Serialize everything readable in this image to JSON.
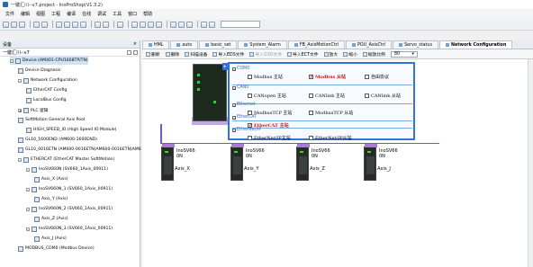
{
  "window": {
    "title": "一键汇川--v7.project - InoProShop(V1.3.2)"
  },
  "menu": [
    "文件",
    "编辑",
    "视图",
    "工程",
    "编译",
    "在线",
    "调试",
    "工具",
    "窗口",
    "帮助"
  ],
  "left_panel": {
    "title": "设备",
    "subtitle": "一键汇川--v7",
    "tree": [
      {
        "label": "Device (AM401-CPU1608TP/TN)",
        "indent": 1,
        "exp": "-",
        "sel": true
      },
      {
        "label": "Device Diagnosis",
        "indent": 2
      },
      {
        "label": "Network Configuration",
        "indent": 2,
        "exp": "-"
      },
      {
        "label": "EtherCAT Config",
        "indent": 3
      },
      {
        "label": "LocalBus Config",
        "indent": 3
      },
      {
        "label": "PLC 逻辑",
        "indent": 2,
        "exp": "+"
      },
      {
        "label": "SoftMotion General Axis Pool",
        "indent": 2
      },
      {
        "label": "HIGH_SPEED_IO (High Speed IO Module)",
        "indent": 3
      },
      {
        "label": "GL10_1600END (AM600-1600END)",
        "indent": 2
      },
      {
        "label": "GL10_0016ETN (AM600-0016ETN)AM600-0016ETN)AM6",
        "indent": 2
      },
      {
        "label": "ETHERCAT (EtherCAT Master SoftMotion)",
        "indent": 2,
        "exp": "-"
      },
      {
        "label": "InoSV660N (SV660_1Axis_00911)",
        "indent": 3,
        "exp": "-"
      },
      {
        "label": "Axis_X (Axis)",
        "indent": 4
      },
      {
        "label": "InoSV660N_1 (SV660_1Axis_00911)",
        "indent": 3,
        "exp": "-"
      },
      {
        "label": "Axis_Y (Axis)",
        "indent": 4
      },
      {
        "label": "InoSV660N_2 (SV660_1Axis_00911)",
        "indent": 3,
        "exp": "-"
      },
      {
        "label": "Axis_Z (Axis)",
        "indent": 4
      },
      {
        "label": "InoSV660N_3 (SV660_1Axis_00911)",
        "indent": 3,
        "exp": "-"
      },
      {
        "label": "Axis_J (Axis)",
        "indent": 4
      },
      {
        "label": "MODBUS_COM0 (Modbus Device)",
        "indent": 2
      }
    ]
  },
  "tabs": [
    {
      "label": "HML",
      "active": false
    },
    {
      "label": "auto",
      "active": false
    },
    {
      "label": "basic_set",
      "active": false
    },
    {
      "label": "System_Alarm",
      "active": false
    },
    {
      "label": "FB_AxisMotionCtrl",
      "active": false
    },
    {
      "label": "POU_AxisCtrl",
      "active": false
    },
    {
      "label": "Servo_status",
      "active": false
    },
    {
      "label": "Network Configuration",
      "active": true
    }
  ],
  "subtoolbar": {
    "items": [
      {
        "label": "删新",
        "dis": false
      },
      {
        "label": "删除",
        "dis": false
      },
      {
        "label": "扫描设备",
        "dis": false
      },
      {
        "label": "导入EDS文件",
        "dis": false
      },
      {
        "label": "导入GSD文件",
        "dis": true
      },
      {
        "label": "导入ECT文件",
        "dis": false
      },
      {
        "label": "放大",
        "dis": false
      },
      {
        "label": "缩小",
        "dis": false
      },
      {
        "label": "缩放比例",
        "dis": false
      }
    ],
    "zoom": "80"
  },
  "popup": {
    "groups": [
      {
        "name": "COM0",
        "checked": "✓",
        "options": [
          {
            "label": "Modbus 主站",
            "checked": false,
            "red": false
          },
          {
            "label": "Modbus 从站",
            "checked": true,
            "red": true
          },
          {
            "label": "自由协议",
            "checked": false,
            "red": false
          }
        ]
      },
      {
        "name": "CAN0",
        "checked": "✓",
        "options": [
          {
            "label": "CANopen 主站",
            "checked": false,
            "red": false
          },
          {
            "label": "CANlink 主站",
            "checked": false,
            "red": false
          },
          {
            "label": "CANlink 从站",
            "checked": false,
            "red": false
          }
        ]
      },
      {
        "name": "Ethernet",
        "checked": "✓",
        "options": [
          {
            "label": "ModbusTCP 主站",
            "checked": false,
            "red": false
          },
          {
            "label": "ModbusTCP 从站",
            "checked": false,
            "red": false
          }
        ]
      },
      {
        "name": "EtherCAT",
        "checked": "✓",
        "options": [
          {
            "label": "EtherCAT 主站",
            "checked": true,
            "red": true
          }
        ]
      },
      {
        "name": "EtherNet/IP",
        "checked": "✓",
        "options": [
          {
            "label": "EtherNet/IP主站",
            "checked": false,
            "red": false
          },
          {
            "label": "EtherNet/IP从站",
            "checked": false,
            "red": false
          }
        ]
      }
    ]
  },
  "drives": [
    {
      "model": "InoSV66",
      "unit": "0N",
      "axis": "Axis_X"
    },
    {
      "model": "InoSV66",
      "unit": "0N",
      "axis": "Axis_Y"
    },
    {
      "model": "InoSV66",
      "unit": "0N",
      "axis": "Axis_Z"
    },
    {
      "model": "InoSV66",
      "unit": "0N",
      "axis": "Axis_J"
    }
  ],
  "colors": {
    "accent": "#3173d6",
    "line": "#6a5acd",
    "red": "#d01010"
  }
}
